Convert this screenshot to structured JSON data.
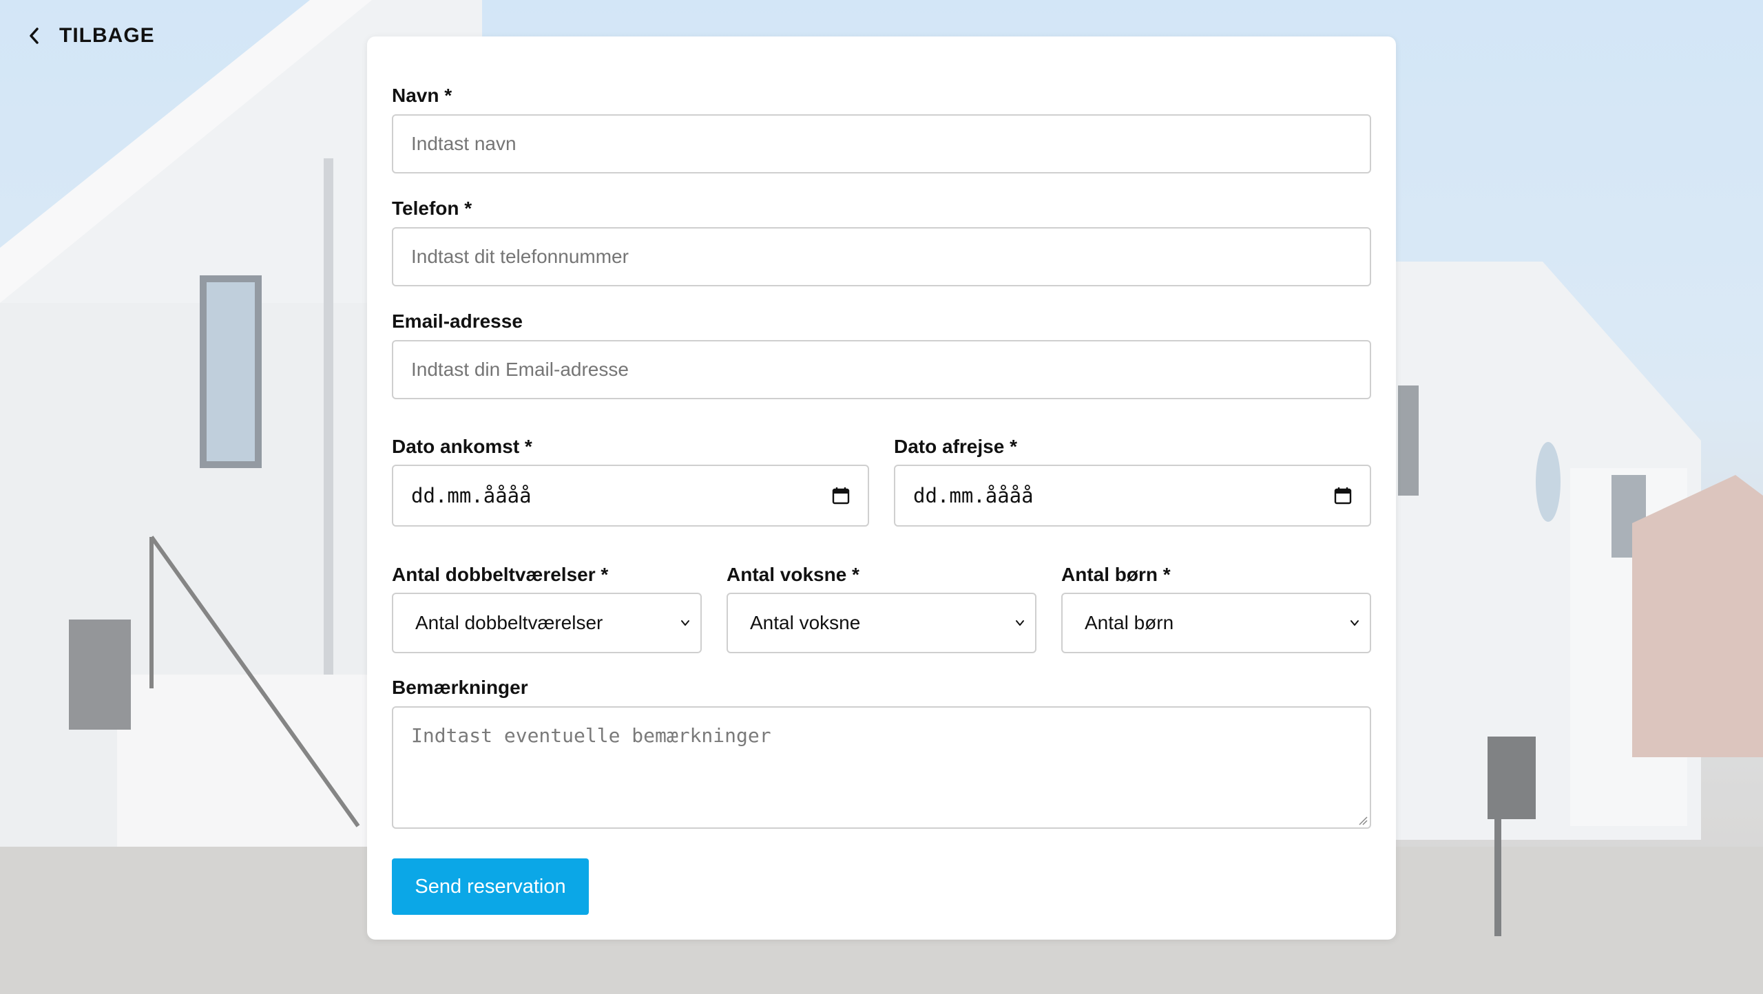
{
  "nav": {
    "back_label": "TILBAGE"
  },
  "form": {
    "name": {
      "label": "Navn *",
      "placeholder": "Indtast navn"
    },
    "phone": {
      "label": "Telefon *",
      "placeholder": "Indtast dit telefonnummer"
    },
    "email": {
      "label": "Email-adresse",
      "placeholder": "Indtast din Email-adresse"
    },
    "arrival": {
      "label": "Dato ankomst *",
      "value": "dd.mm.åååå"
    },
    "departure": {
      "label": "Dato afrejse *",
      "value": "dd.mm.åååå"
    },
    "rooms": {
      "label": "Antal dobbeltværelser *",
      "selected": "Antal dobbeltværelser"
    },
    "adults": {
      "label": "Antal voksne *",
      "selected": "Antal voksne"
    },
    "children": {
      "label": "Antal børn *",
      "selected": "Antal børn"
    },
    "remarks": {
      "label": "Bemærkninger",
      "placeholder": "Indtast eventuelle bemærkninger"
    },
    "submit_label": "Send reservation"
  },
  "colors": {
    "accent": "#0ba7e7",
    "card": "#ffffff",
    "border": "#cfcfcf"
  },
  "icons": {
    "back": "chevron-left-icon",
    "date": "calendar-icon",
    "select": "chevron-down-icon",
    "textarea": "resize-grip-icon"
  }
}
